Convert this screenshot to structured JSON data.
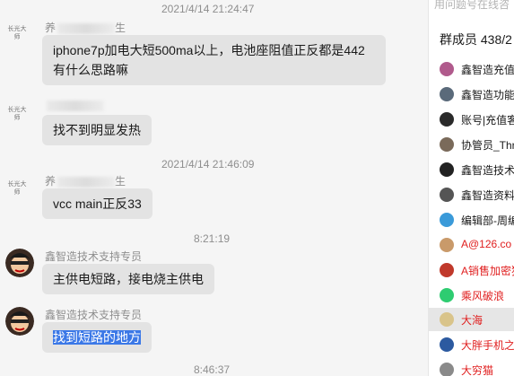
{
  "messages": [
    {
      "type": "time",
      "text": "2021/4/14 21:24:47"
    },
    {
      "type": "msg",
      "avatar_label": "长光大师",
      "sender": "养",
      "sender_suffix": "生",
      "text": "iphone7p加电大短500ma以上，电池座阻值正反都是442有什么思路嘛"
    },
    {
      "type": "msg",
      "avatar_label": "长光大师",
      "sender": "",
      "sender_suffix": "",
      "text": "找不到明显发热"
    },
    {
      "type": "time",
      "text": "2021/4/14 21:46:09"
    },
    {
      "type": "msg",
      "avatar_label": "长光大师",
      "sender": "养",
      "sender_suffix": "生",
      "text": "vcc main正反33"
    },
    {
      "type": "time",
      "text": "8:21:19"
    },
    {
      "type": "msg",
      "avatar_label": "",
      "sender": "鑫智造技术支持专员",
      "text": "主供电短路，接电烧主供电"
    },
    {
      "type": "msg",
      "avatar_label": "",
      "sender": "鑫智造技术支持专员",
      "text": "找到短路的地方"
    },
    {
      "type": "time",
      "text": "8:46:37"
    }
  ],
  "panel": {
    "search_placeholder": "用问题号在线咨",
    "member_count_label": "群成员 438/2",
    "members": [
      {
        "name": "鑫智造充值",
        "color": "#1a1a1a",
        "icon": "avatar-icon"
      },
      {
        "name": "鑫智造功能",
        "color": "#1a1a1a",
        "icon": "avatar-icon"
      },
      {
        "name": "账号|充值客",
        "color": "#1a1a1a",
        "icon": "avatar-icon"
      },
      {
        "name": "协管员_Thr",
        "color": "#1a1a1a",
        "icon": "avatar-icon"
      },
      {
        "name": "鑫智造技术",
        "color": "#1a1a1a",
        "icon": "avatar-icon"
      },
      {
        "name": "鑫智造资料",
        "color": "#1a1a1a",
        "icon": "avatar-icon"
      },
      {
        "name": "编辑部-周编",
        "color": "#1a1a1a",
        "icon": "avatar-icon"
      },
      {
        "name": "A@126.co",
        "color": "#e02020",
        "icon": "avatar-icon"
      },
      {
        "name": "A销售加密狗",
        "color": "#e02020",
        "icon": "avatar-icon"
      },
      {
        "name": "乘风破浪",
        "color": "#e02020",
        "icon": "avatar-icon"
      },
      {
        "name": "大海",
        "color": "#e02020",
        "icon": "avatar-icon"
      },
      {
        "name": "大胖手机之",
        "color": "#e02020",
        "icon": "avatar-icon"
      },
      {
        "name": "大穷猫",
        "color": "#e02020",
        "icon": "avatar-icon"
      }
    ]
  }
}
